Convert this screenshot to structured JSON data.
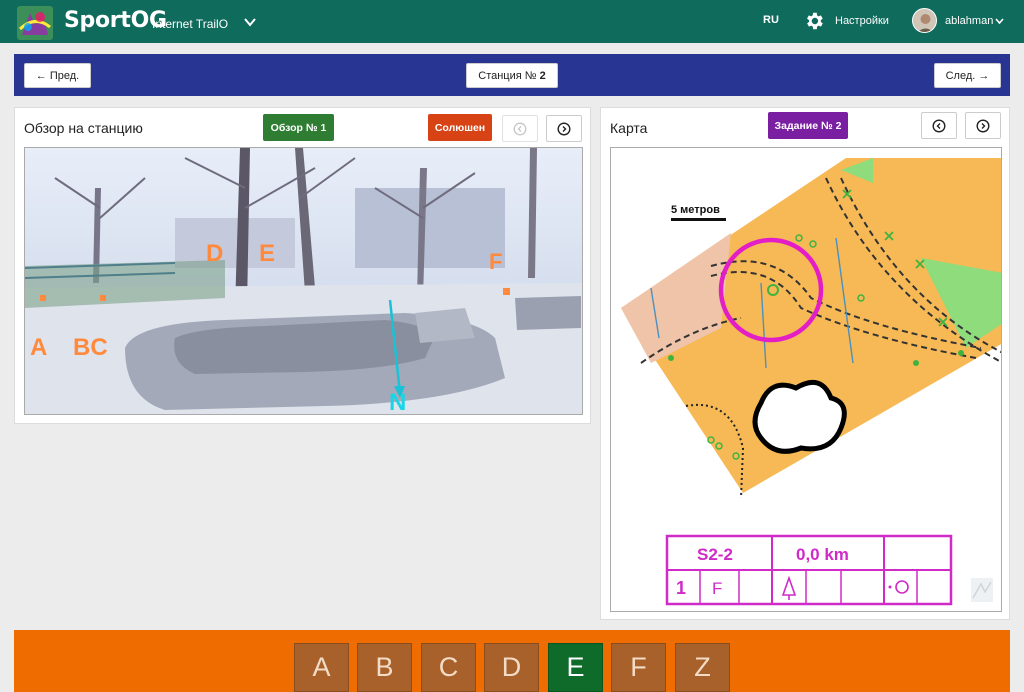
{
  "header": {
    "brand": "SportOG",
    "brand_sub": "Internet TrailO",
    "lang": "RU",
    "settings_label": "Настройки",
    "username": "ablahman"
  },
  "nav": {
    "prev_label": "← Пред.",
    "station_label": "Станция №",
    "station_number": "2",
    "next_label": "След. →"
  },
  "view_panel": {
    "title": "Обзор на станцию",
    "view_badge": "Обзор № 1",
    "solution_button": "Солюшен",
    "photo_labels": {
      "a": "A",
      "bc": "BC",
      "d": "D",
      "e": "E",
      "f": "F",
      "n": "N"
    }
  },
  "map_panel": {
    "title": "Карта",
    "task_badge": "Задание № 2",
    "scale_label": "5 метров",
    "control_card": {
      "course": "S2-2",
      "distance": "0,0 km",
      "number": "1",
      "code": "F"
    }
  },
  "answers": [
    "A",
    "B",
    "C",
    "D",
    "E",
    "F",
    "Z"
  ],
  "selected_answer": "E",
  "colors": {
    "header": "#0f6b5c",
    "nav": "#283593",
    "answer_bar": "#ef6c00",
    "answer_tile": "#a8612a",
    "answer_selected": "#0f6b2a",
    "view_badge": "#2e7d32",
    "solution_button": "#d84315",
    "task_badge": "#7b1fa2"
  }
}
